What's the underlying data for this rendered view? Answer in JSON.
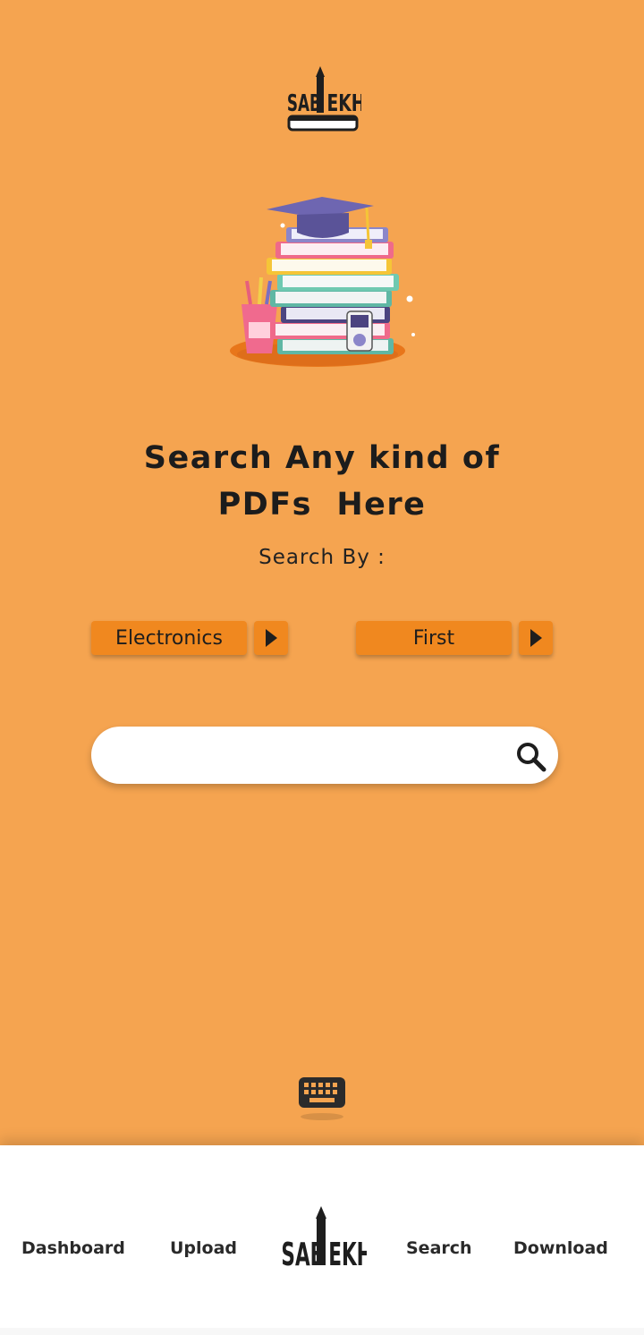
{
  "brand": {
    "logo_text": "SABLEKH",
    "accent_color": "#f0881f",
    "background_color": "#f5a450"
  },
  "headline": {
    "line1": "Search Any kind of",
    "line2": "PDFs  Here"
  },
  "search_by_label": "Search By :",
  "filters": [
    {
      "selected": "Electronics",
      "icon": "play-arrow-icon"
    },
    {
      "selected": "First",
      "icon": "play-arrow-icon"
    }
  ],
  "search": {
    "placeholder": "",
    "value": "",
    "icon": "search-icon"
  },
  "keyboard_icon": "keyboard-icon",
  "bottom_nav": {
    "items": [
      {
        "label": "Dashboard"
      },
      {
        "label": "Upload"
      },
      {
        "label": "Search"
      },
      {
        "label": "Download"
      }
    ]
  }
}
